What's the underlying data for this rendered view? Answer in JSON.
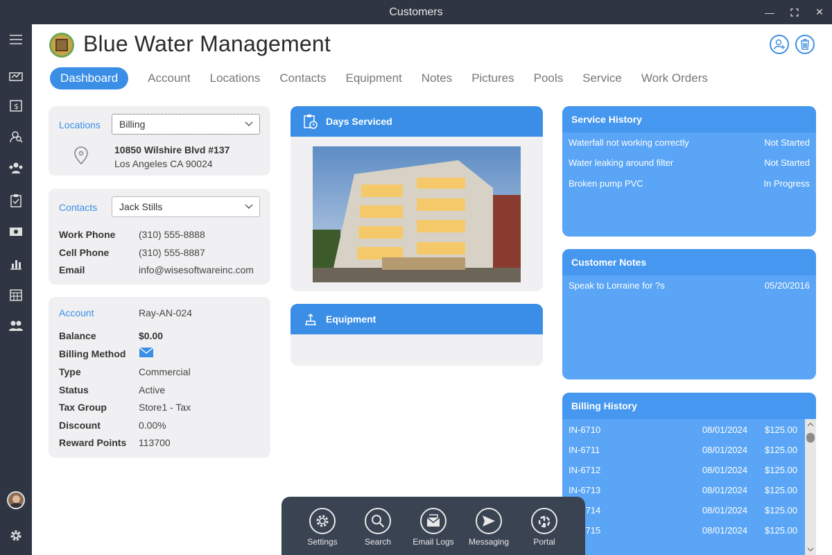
{
  "window": {
    "title": "Customers"
  },
  "sidebar": {
    "items": [
      "menu-icon",
      "dashboard-icon",
      "invoice-icon",
      "search-person-icon",
      "contacts-icon",
      "clipboard-icon",
      "money-icon",
      "chart-icon",
      "calendar-icon",
      "team-icon"
    ]
  },
  "header": {
    "company": "Blue Water Management"
  },
  "tabs": [
    "Dashboard",
    "Account",
    "Locations",
    "Contacts",
    "Equipment",
    "Notes",
    "Pictures",
    "Pools",
    "Service",
    "Work Orders"
  ],
  "locations": {
    "label": "Locations",
    "selected": "Billing",
    "address1": "10850 Wilshire Blvd #137",
    "address2": "Los Angeles CA 90024"
  },
  "contacts": {
    "label": "Contacts",
    "selected": "Jack Stills",
    "work_phone_label": "Work Phone",
    "work_phone": "(310) 555-8888",
    "cell_phone_label": "Cell Phone",
    "cell_phone": "(310) 555-8887",
    "email_label": "Email",
    "email": "info@wisesoftwareinc.com"
  },
  "account": {
    "label": "Account",
    "id": "Ray-AN-024",
    "balance_label": "Balance",
    "balance": "$0.00",
    "billing_method_label": "Billing Method",
    "type_label": "Type",
    "type": "Commercial",
    "status_label": "Status",
    "status": "Active",
    "tax_group_label": "Tax Group",
    "tax_group": "Store1 - Tax",
    "discount_label": "Discount",
    "discount": "0.00%",
    "reward_points_label": "Reward Points",
    "reward_points": "113700"
  },
  "days_serviced": {
    "title": "Days Serviced"
  },
  "equipment": {
    "title": "Equipment"
  },
  "service_history": {
    "title": "Service History",
    "rows": [
      {
        "desc": "Waterfall not working correctly",
        "status": "Not Started"
      },
      {
        "desc": "Water leaking around filter",
        "status": "Not Started"
      },
      {
        "desc": "Broken pump PVC",
        "status": "In Progress"
      }
    ]
  },
  "customer_notes": {
    "title": "Customer Notes",
    "rows": [
      {
        "note": "Speak to Lorraine for ?s",
        "date": "05/20/2016"
      }
    ]
  },
  "billing_history": {
    "title": "Billing History",
    "rows": [
      {
        "inv": "IN-6710",
        "date": "08/01/2024",
        "amount": "$125.00"
      },
      {
        "inv": "IN-6711",
        "date": "08/01/2024",
        "amount": "$125.00"
      },
      {
        "inv": "IN-6712",
        "date": "08/01/2024",
        "amount": "$125.00"
      },
      {
        "inv": "IN-6713",
        "date": "08/01/2024",
        "amount": "$125.00"
      },
      {
        "inv": "IN-6714",
        "date": "08/01/2024",
        "amount": "$125.00"
      },
      {
        "inv": "IN-6715",
        "date": "08/01/2024",
        "amount": "$125.00"
      }
    ]
  },
  "dock": {
    "settings": "Settings",
    "search": "Search",
    "email_logs": "Email Logs",
    "messaging": "Messaging",
    "portal": "Portal"
  }
}
